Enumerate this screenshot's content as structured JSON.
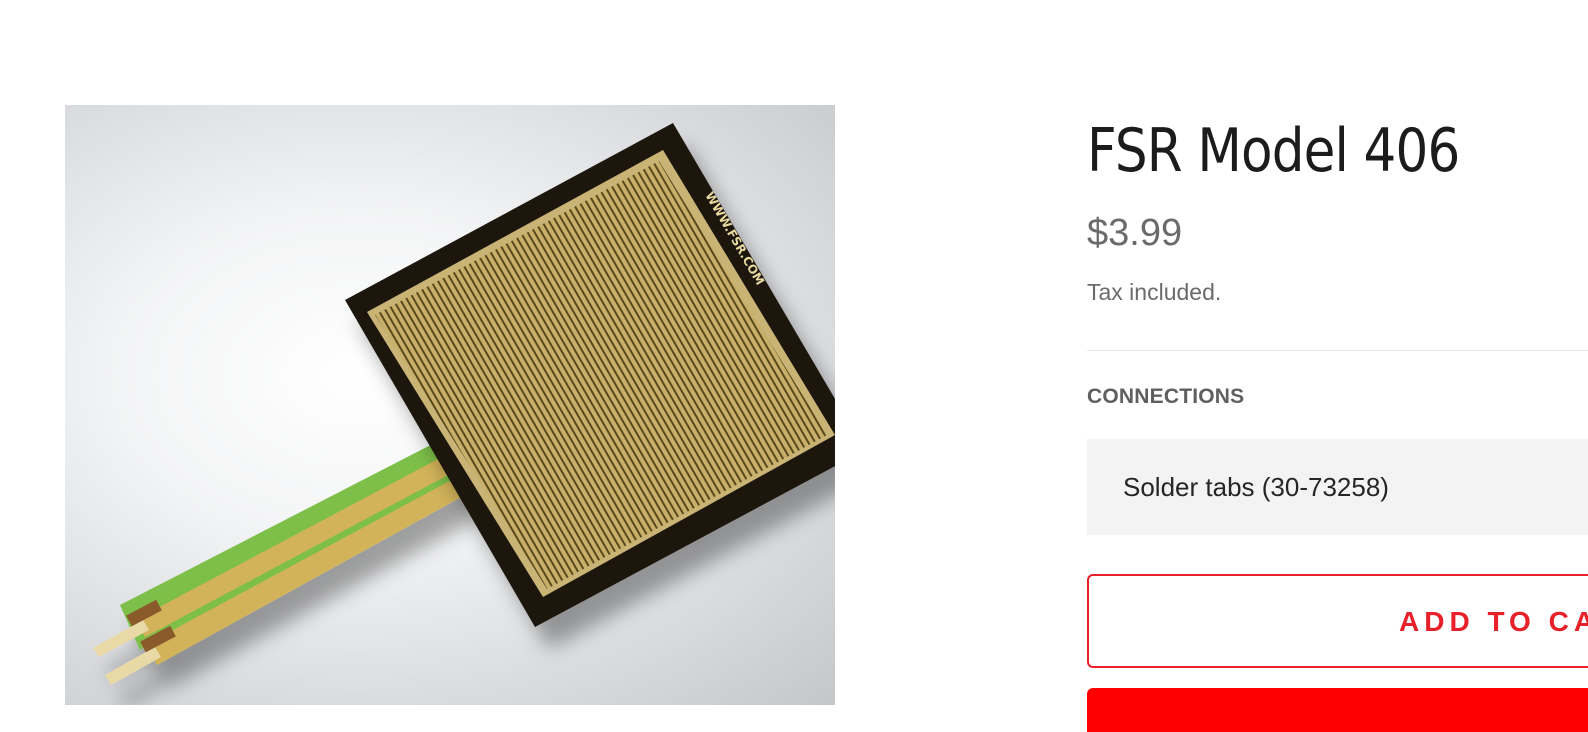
{
  "product": {
    "title": "FSR Model 406",
    "price": "$3.99",
    "tax_note": "Tax included."
  },
  "image": {
    "alt": "FSR Model 406 square force sensing resistor",
    "imprint": "WWW.FSR.COM"
  },
  "options": {
    "label": "CONNECTIONS",
    "selected": "Solder tabs (30-73258)"
  },
  "actions": {
    "add_to_cart_label": "ADD TO CART",
    "buy_now_label": ""
  },
  "colors": {
    "accent": "#e8202a",
    "buy_now": "#ff0000"
  }
}
